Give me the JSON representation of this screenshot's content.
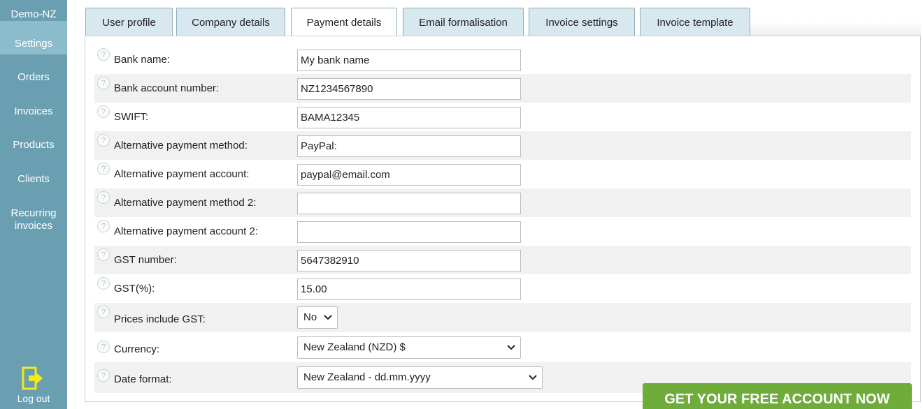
{
  "sidebar": {
    "brand": "Demo-NZ",
    "items": [
      {
        "label": "Settings"
      },
      {
        "label": "Orders"
      },
      {
        "label": "Invoices"
      },
      {
        "label": "Products"
      },
      {
        "label": "Clients"
      },
      {
        "label_line1": "Recurring",
        "label_line2": "invoices"
      }
    ],
    "logout_label": "Log out"
  },
  "tabs": [
    {
      "label": "User profile"
    },
    {
      "label": "Company details"
    },
    {
      "label": "Payment details",
      "active": true
    },
    {
      "label": "Email formalisation"
    },
    {
      "label": "Invoice settings"
    },
    {
      "label": "Invoice template"
    }
  ],
  "form": {
    "bank_name": {
      "label": "Bank name:",
      "value": "My bank name"
    },
    "bank_account": {
      "label": "Bank account number:",
      "value": "NZ1234567890"
    },
    "swift": {
      "label": "SWIFT:",
      "value": "BAMA12345"
    },
    "alt_method": {
      "label": "Alternative payment method:",
      "value": "PayPal:"
    },
    "alt_account": {
      "label": "Alternative payment account:",
      "value": "paypal@email.com"
    },
    "alt_method_2": {
      "label": "Alternative payment method 2:",
      "value": ""
    },
    "alt_account_2": {
      "label": "Alternative payment account 2:",
      "value": ""
    },
    "gst_number": {
      "label": "GST number:",
      "value": "5647382910"
    },
    "gst_percent": {
      "label": "GST(%):",
      "value": "15.00"
    },
    "prices_include_gst": {
      "label": "Prices include GST:",
      "selected": "No"
    },
    "currency": {
      "label": "Currency:",
      "selected": "New Zealand (NZD) $"
    },
    "date_format": {
      "label": "Date format:",
      "selected": "New Zealand - dd.mm.yyyy"
    }
  },
  "help_glyph": "?",
  "cta": {
    "label": "GET YOUR FREE ACCOUNT NOW"
  },
  "colors": {
    "sidebar": "#6a9fb2",
    "sidebar_active": "#8bbccc",
    "tab_bg": "#d8e8ef",
    "cta": "#6fac3a",
    "logout_icon": "#f2ea1c"
  }
}
